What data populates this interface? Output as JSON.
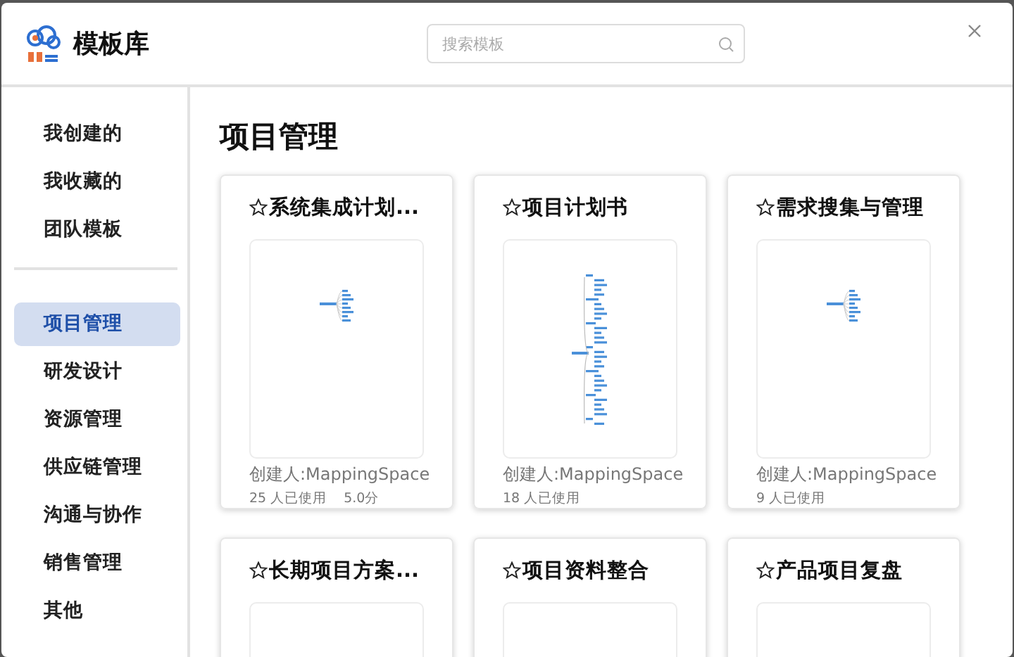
{
  "header": {
    "title": "模板库",
    "search": {
      "placeholder": "搜索模板"
    }
  },
  "sidebar": {
    "groups": [
      {
        "items": [
          {
            "label": "我创建的",
            "selected": false
          },
          {
            "label": "我收藏的",
            "selected": false
          },
          {
            "label": "团队模板",
            "selected": false
          }
        ]
      },
      {
        "items": [
          {
            "label": "项目管理",
            "selected": true
          },
          {
            "label": "研发设计",
            "selected": false
          },
          {
            "label": "资源管理",
            "selected": false
          },
          {
            "label": "供应链管理",
            "selected": false
          },
          {
            "label": "沟通与协作",
            "selected": false
          },
          {
            "label": "销售管理",
            "selected": false
          },
          {
            "label": "其他",
            "selected": false
          }
        ]
      }
    ]
  },
  "content": {
    "heading": "项目管理",
    "cards": [
      {
        "title": "系统集成计划...",
        "starred": false,
        "kind": "small_map",
        "creator": "创建人:MappingSpace",
        "uses": "25 人已使用",
        "rating": "5.0分"
      },
      {
        "title": "项目计划书",
        "starred": false,
        "kind": "tall_map",
        "creator": "创建人:MappingSpace",
        "uses": "18 人已使用"
      },
      {
        "title": "需求搜集与管理",
        "starred": false,
        "kind": "small_map",
        "creator": "创建人:MappingSpace",
        "uses": "9 人已使用"
      },
      {
        "title": "长期项目方案...",
        "starred": false
      },
      {
        "title": "项目资料整合",
        "starred": false
      },
      {
        "title": "产品项目复盘",
        "starred": false
      }
    ]
  }
}
